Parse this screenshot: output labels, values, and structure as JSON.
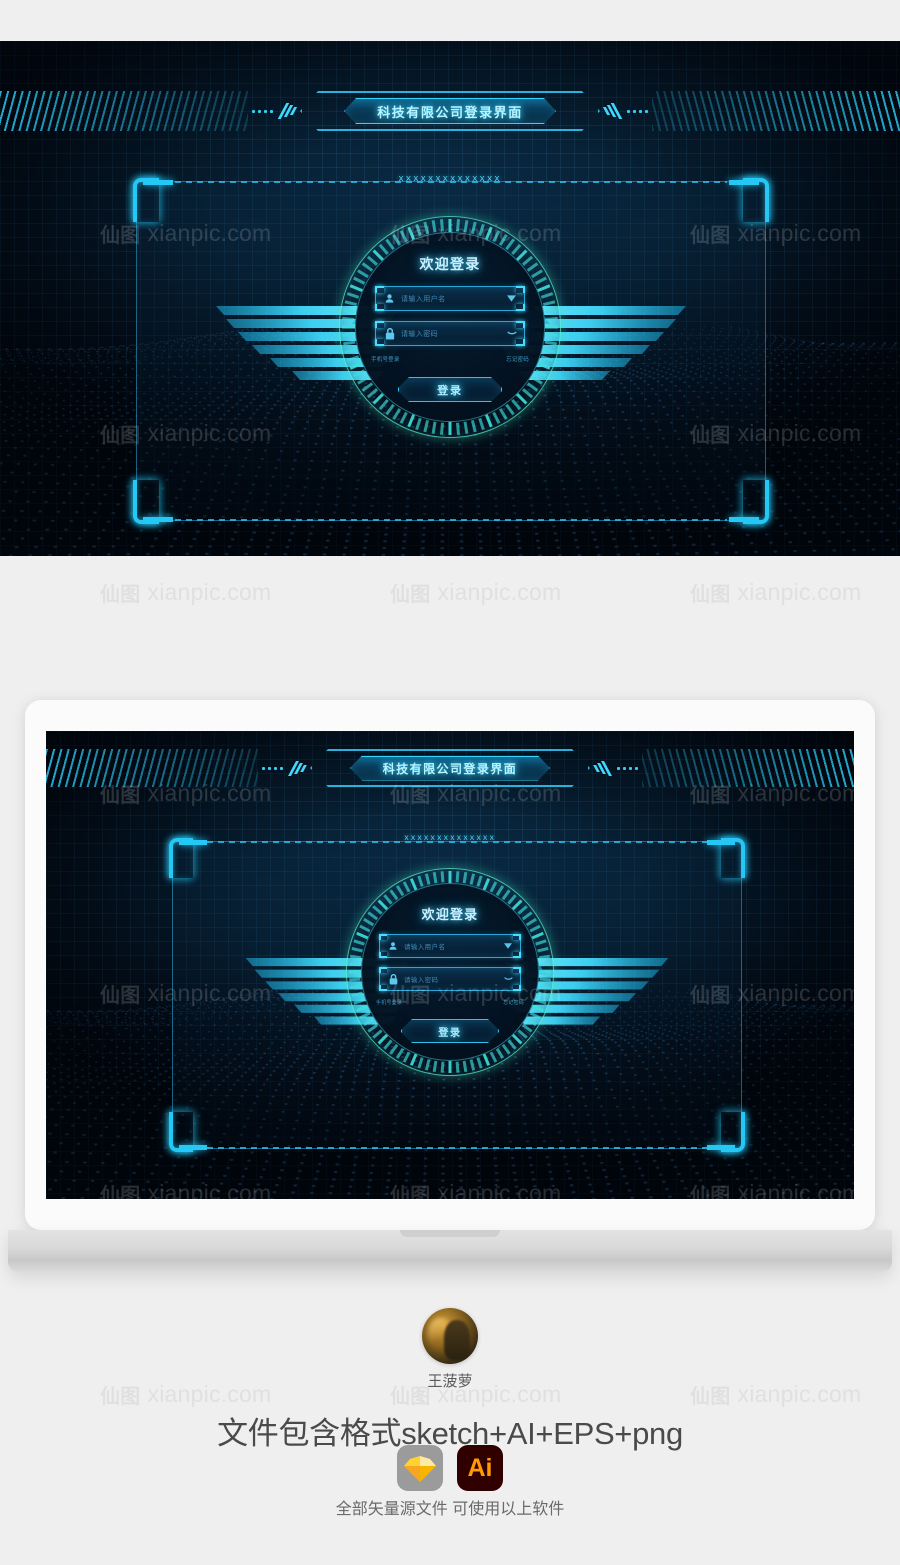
{
  "watermark": {
    "mark": "仙图",
    "text": "xianpic.com"
  },
  "hero": {
    "banner": {
      "title": "科技有限公司登录界面"
    },
    "panel": {
      "placeholder_string": "xxxxxxxxxxxxxx"
    },
    "login": {
      "heading": "欢迎登录",
      "username": {
        "placeholder": "请输入用户名",
        "icon": "user-icon",
        "trailing_icon": "chevron-down-icon"
      },
      "password": {
        "placeholder": "请输入密码",
        "icon": "lock-icon",
        "trailing_icon": "eye-icon"
      },
      "links": {
        "phone": "手机号登录",
        "forgot": "忘记密码"
      },
      "submit": "登录"
    },
    "emblem": {
      "name": "wings-emblem"
    }
  },
  "preview": {
    "device": "laptop-mockup",
    "banner": {
      "title": "科技有限公司登录界面"
    },
    "panel": {
      "placeholder_string": "xxxxxxxxxxxxxx"
    },
    "login": {
      "heading": "欢迎登录",
      "username": {
        "placeholder": "请输入用户名"
      },
      "password": {
        "placeholder": "请输入密码"
      },
      "links": {
        "phone": "手机号登录",
        "forgot": "忘记密码"
      },
      "submit": "登录"
    }
  },
  "footer": {
    "author": "王菠萝",
    "formats": "文件包含格式sketch+AI+EPS+png",
    "apps": [
      {
        "name": "sketch-icon",
        "label": ""
      },
      {
        "name": "illustrator-icon",
        "label": "Ai"
      }
    ],
    "tagline": "全部矢量源文件 可使用以上软件"
  },
  "colors": {
    "accent_cyan": "#2fc4ef",
    "glow_cyan": "#46ddff",
    "ring_teal": "#5af0c8",
    "dark_bg": "#03101d",
    "page_bg": "#efefef",
    "ai_orange": "#ff9a00",
    "sketch_gray": "#9b9b9b"
  }
}
